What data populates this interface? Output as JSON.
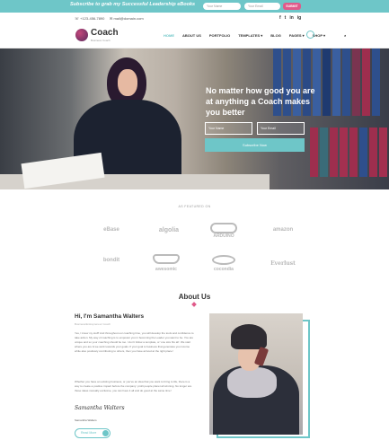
{
  "promo": {
    "text": "Subscribe to grab my Successful Leadership eBooks",
    "name_placeholder": "Your Name",
    "email_placeholder": "Your Email",
    "button": "SUBMIT"
  },
  "contact": {
    "phone": "+123-456-7890",
    "email": "mail@domain.com",
    "social": [
      "f",
      "t",
      "in",
      "ig"
    ]
  },
  "logo": {
    "name": "Coach",
    "tagline": "Business Coach"
  },
  "nav": {
    "items": [
      "HOME",
      "ABOUT US",
      "PORTFOLIO",
      "TEMPLATES ▾",
      "BLOG",
      "PAGES ▾",
      "SHOP ▾"
    ],
    "active_index": 0,
    "cart_count": "0"
  },
  "hero": {
    "title": "No matter how good you are at anything a Coach makes you better",
    "name_placeholder": "Your Name",
    "email_placeholder": "Your Email",
    "button": "Subscribe Now"
  },
  "featured": {
    "title": "AS FEATURED ON",
    "brands": [
      "eBase",
      "algolia",
      "ARDUINO",
      "amazon",
      "bondit",
      "awesomic",
      "cocondia",
      "Everlust"
    ]
  },
  "about": {
    "title": "About Us",
    "heading": "Hi, I'm Samantha Walters",
    "role": "Business/Entrepreneur Coach",
    "paragraph1": "Yes, I know my stuff! And throughout our coaching time, you will develop the tools and confidence to take action. My way of coaching is to empower you in becoming the Leader you want to be. You are unique and so your coaching should be too. I don't follow a template, or 'one size fits all'. We start where you are & we work towards your goals. If your goal is business that generates you income while also positively contributing to others, then you have arrived at the right place!",
    "paragraph2": "Whether you have an existing business, or you've an idea that you want to bring to life, there is a way to create a positive impact before the company: profit people planet all winning. No longer are those ideas mutually exclusive, you can have it all and do good at the same time!",
    "signature": "Samantha Walters",
    "signature_name": "Samantha Walters",
    "read_more": "Read More"
  },
  "colors": {
    "accent": "#6ec6c8",
    "pink": "#e05a8a"
  }
}
